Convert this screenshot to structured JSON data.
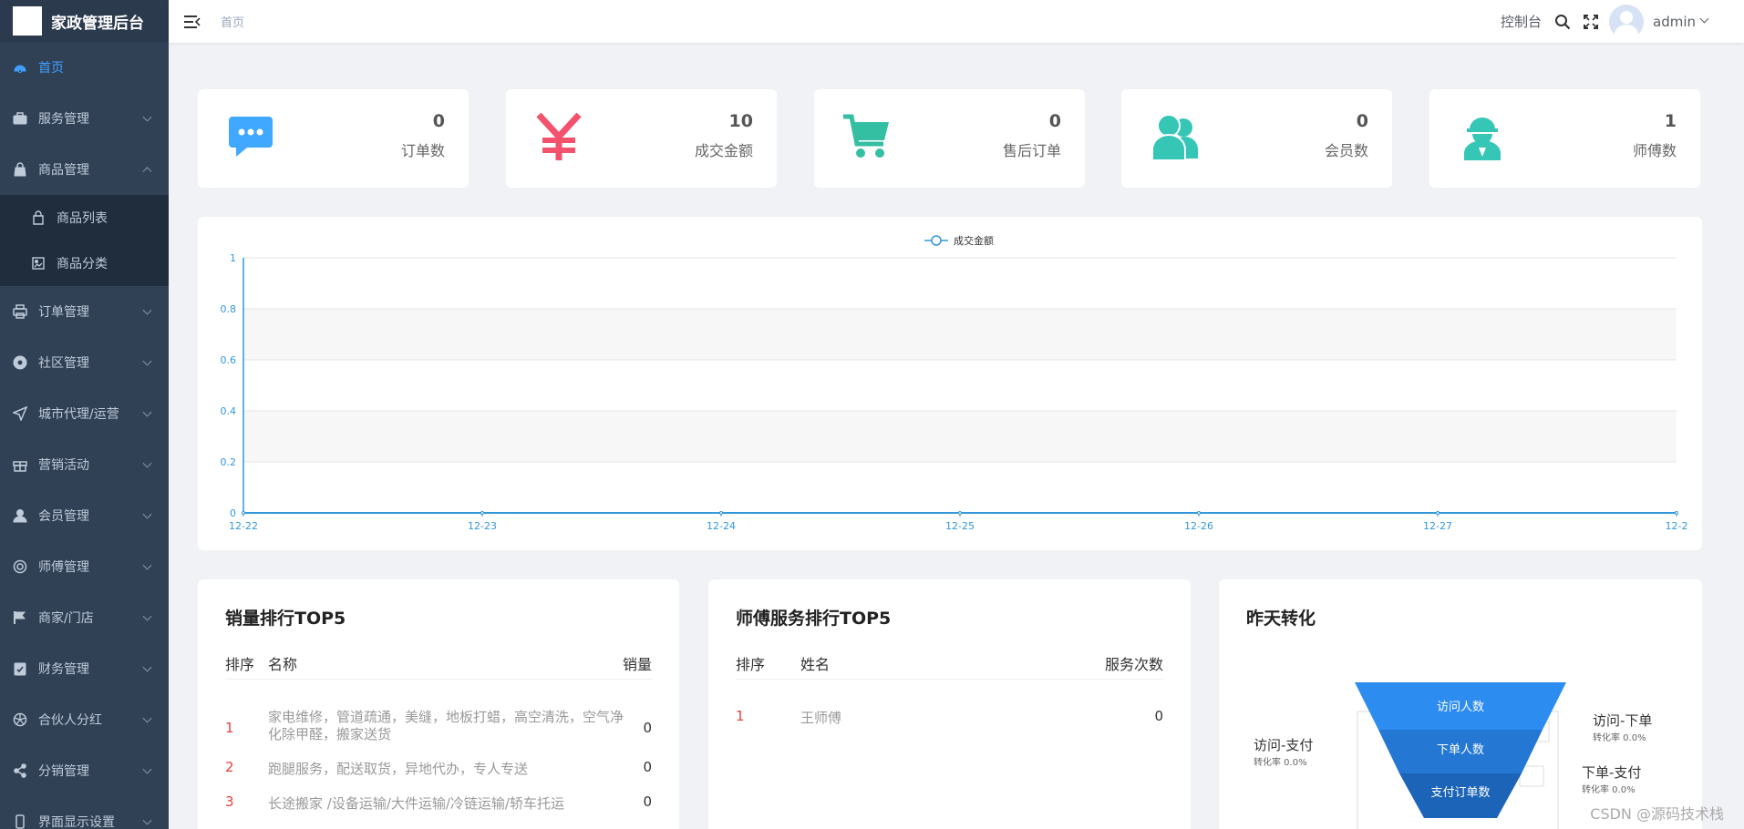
{
  "app": {
    "title": "家政管理后台"
  },
  "sidebar": {
    "items": [
      {
        "label": "首页",
        "icon": "dashboard-icon",
        "active": true,
        "chevron": false
      },
      {
        "label": "服务管理",
        "icon": "briefcase-icon",
        "chevron": true
      },
      {
        "label": "商品管理",
        "icon": "bag-icon",
        "chevron": true,
        "expanded": true
      }
    ],
    "submenu": [
      {
        "label": "商品列表",
        "icon": "shopping-bag-icon"
      },
      {
        "label": "商品分类",
        "icon": "category-icon"
      }
    ],
    "items2": [
      {
        "label": "订单管理",
        "icon": "printer-icon"
      },
      {
        "label": "社区管理",
        "icon": "lifebuoy-icon"
      },
      {
        "label": "城市代理/运营",
        "icon": "navigation-icon"
      },
      {
        "label": "营销活动",
        "icon": "gift-icon"
      },
      {
        "label": "会员管理",
        "icon": "user-icon"
      },
      {
        "label": "师傅管理",
        "icon": "target-icon"
      },
      {
        "label": "商家/门店",
        "icon": "flag-icon"
      },
      {
        "label": "财务管理",
        "icon": "clipboard-icon"
      },
      {
        "label": "合伙人分红",
        "icon": "aperture-icon"
      },
      {
        "label": "分销管理",
        "icon": "share-icon"
      },
      {
        "label": "界面显示设置",
        "icon": "phone-icon"
      }
    ]
  },
  "header": {
    "breadcrumb": "首页",
    "console": "控制台",
    "user": "admin"
  },
  "stats": [
    {
      "value": "0",
      "label": "订单数",
      "icon": "chat-bubble-icon",
      "color": "#40a9ff"
    },
    {
      "value": "10",
      "label": "成交金额",
      "icon": "yen-icon",
      "color": "#f4516c"
    },
    {
      "value": "0",
      "label": "售后订单",
      "icon": "cart-icon",
      "color": "#34bfa3"
    },
    {
      "value": "0",
      "label": "会员数",
      "icon": "users-icon",
      "color": "#36c6b6"
    },
    {
      "value": "1",
      "label": "师傅数",
      "icon": "worker-icon",
      "color": "#36c6b6"
    }
  ],
  "chart_data": {
    "type": "line",
    "legend": "成交金额",
    "legend_position": "top-center",
    "x": [
      "12-22",
      "12-23",
      "12-24",
      "12-25",
      "12-26",
      "12-27",
      "12-2"
    ],
    "series": [
      {
        "name": "成交金额",
        "values": [
          0,
          0,
          0,
          0,
          0,
          0,
          0
        ]
      }
    ],
    "y_ticks": [
      "0",
      "0.2",
      "0.4",
      "0.6",
      "0.8",
      "1"
    ],
    "ylim": [
      0,
      1
    ],
    "grid": true,
    "color": "#3398db"
  },
  "sales_top": {
    "title": "销量排行TOP5",
    "headers": {
      "rank": "排序",
      "name": "名称",
      "count": "销量"
    },
    "rows": [
      {
        "rank": "1",
        "name": "家电维修，管道疏通，美缝，地板打蜡，高空清洗，空气净化除甲醛，搬家送货",
        "count": "0"
      },
      {
        "rank": "2",
        "name": "跑腿服务，配送取货，异地代办，专人专送",
        "count": "0"
      },
      {
        "rank": "3",
        "name": "长途搬家 /设备运输/大件运输/冷链运输/轿车托运",
        "count": "0"
      }
    ]
  },
  "worker_top": {
    "title": "师傅服务排行TOP5",
    "headers": {
      "rank": "排序",
      "name": "姓名",
      "count": "服务次数"
    },
    "rows": [
      {
        "rank": "1",
        "name": "王师傅",
        "count": "0"
      }
    ]
  },
  "conversion": {
    "title": "昨天转化",
    "funnel": [
      "访问人数",
      "下单人数",
      "支付订单数"
    ],
    "left": {
      "label": "访问-支付",
      "rate": "转化率 0.0%"
    },
    "right_top": {
      "label": "访问-下单",
      "rate": "转化率 0.0%"
    },
    "right_bottom": {
      "label": "下单-支付",
      "rate": "转化率 0.0%"
    }
  },
  "watermark": "CSDN @源码技术栈"
}
